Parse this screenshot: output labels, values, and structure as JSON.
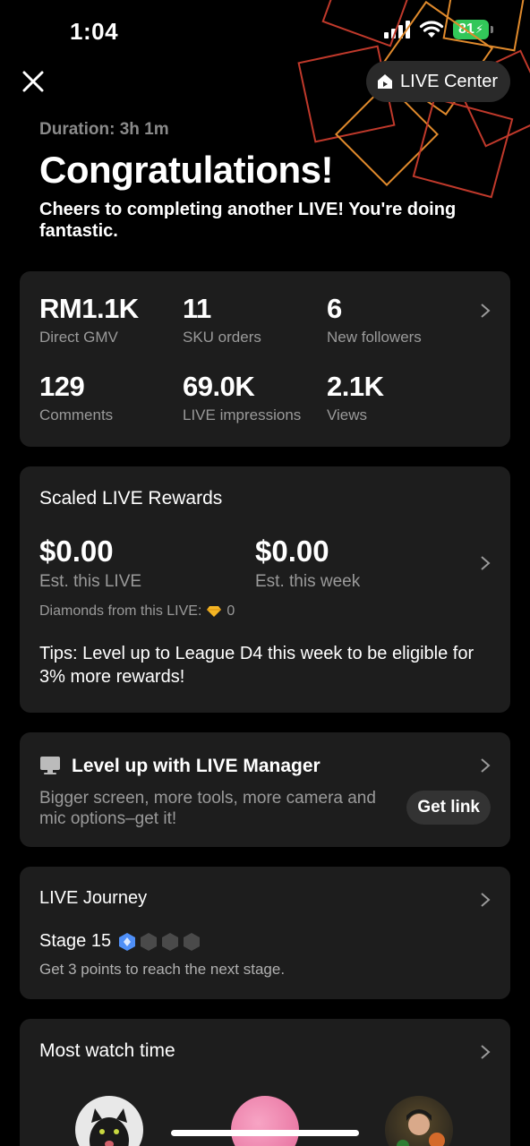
{
  "status_bar": {
    "time": "1:04",
    "battery": "81"
  },
  "header": {
    "live_center_label": "LIVE Center"
  },
  "summary": {
    "duration": "Duration: 3h 1m",
    "title": "Congratulations!",
    "subtitle": "Cheers to completing another LIVE! You're doing fantastic."
  },
  "stats": [
    {
      "value": "RM1.1K",
      "label": "Direct GMV"
    },
    {
      "value": "11",
      "label": "SKU orders"
    },
    {
      "value": "6",
      "label": "New followers"
    },
    {
      "value": "129",
      "label": "Comments"
    },
    {
      "value": "69.0K",
      "label": "LIVE impressions"
    },
    {
      "value": "2.1K",
      "label": "Views"
    }
  ],
  "rewards": {
    "title": "Scaled LIVE Rewards",
    "this_live_value": "$0.00",
    "this_live_label": "Est. this LIVE",
    "this_week_value": "$0.00",
    "this_week_label": "Est. this week",
    "diamonds_label": "Diamonds from this LIVE:",
    "diamonds_value": "0",
    "tips": "Tips: Level up to League D4 this week to be eligible for 3% more rewards!"
  },
  "live_manager": {
    "title": "Level up with LIVE Manager",
    "description": "Bigger screen, more tools, more camera and mic options–get it!",
    "button_label": "Get link"
  },
  "journey": {
    "title": "LIVE Journey",
    "stage_label": "Stage 15",
    "description": "Get 3 points to reach the next stage.",
    "filled_stages": 1,
    "total_stages": 4
  },
  "most_watch": {
    "title": "Most watch time"
  },
  "colors": {
    "card_bg": "#1d1d1d",
    "battery": "#32c759",
    "stage_active": "#4f8ff7",
    "muted_text": "#9a9a9a"
  }
}
